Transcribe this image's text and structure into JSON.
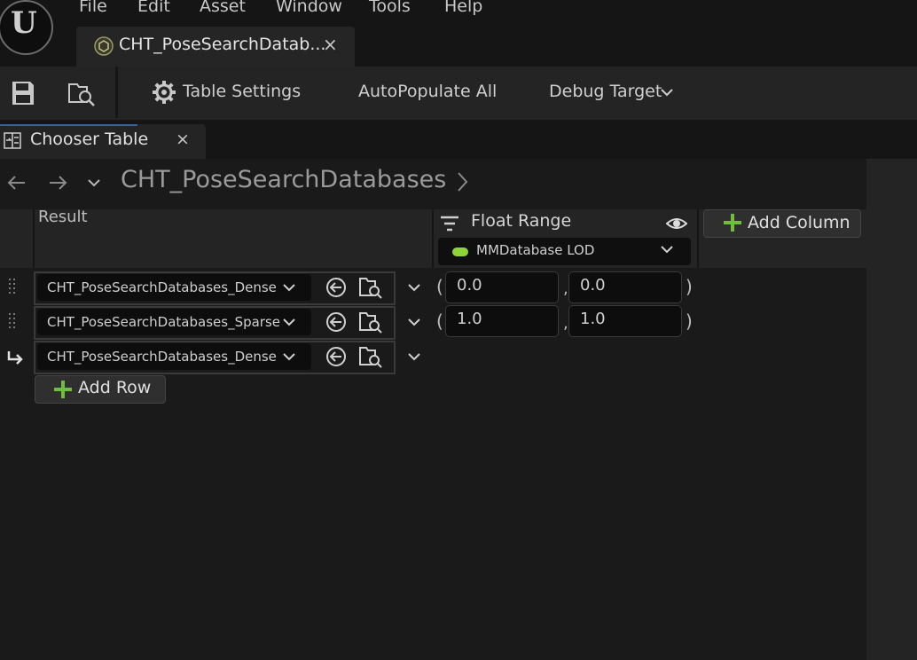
{
  "menu": [
    "File",
    "Edit",
    "Asset",
    "Window",
    "Tools",
    "Help"
  ],
  "doc_tab": {
    "label": "CHT_PoseSearchDatab...",
    "close": "×"
  },
  "toolbar": {
    "table_settings": "Table Settings",
    "autopopulate": "AutoPopulate All",
    "debug_target": "Debug Target"
  },
  "panel_tab": {
    "label": "Chooser Table",
    "close": "×"
  },
  "breadcrumb": {
    "path": "CHT_PoseSearchDatabases"
  },
  "table": {
    "result_header": "Result",
    "float_range_header": "Float Range",
    "parameter": "MMDatabase LOD",
    "add_column": "Add Column",
    "add_row": "Add Row",
    "rows": [
      {
        "result": "CHT_PoseSearchDatabases_Dense",
        "min": "0.0",
        "max": "0.0"
      },
      {
        "result": "CHT_PoseSearchDatabases_Sparse",
        "min": "1.0",
        "max": "1.0"
      }
    ],
    "fallback_row": {
      "result": "CHT_PoseSearchDatabases_Dense"
    },
    "paren_open": "(",
    "paren_close": ")",
    "comma": ","
  },
  "colors": {
    "accent_green": "#8ed438",
    "plus_green": "#6fbf3a",
    "panel_bg": "#1a1a1a"
  },
  "icons": [
    "unreal-logo-icon",
    "asset-icon",
    "save-icon",
    "browse-asset-icon",
    "gear-icon",
    "chevron-down-icon",
    "chooser-table-icon",
    "back-arrow-icon",
    "forward-arrow-icon",
    "filter-icon",
    "eye-icon",
    "plus-icon",
    "grip-icon",
    "use-selected-icon",
    "fallback-arrow-icon"
  ]
}
